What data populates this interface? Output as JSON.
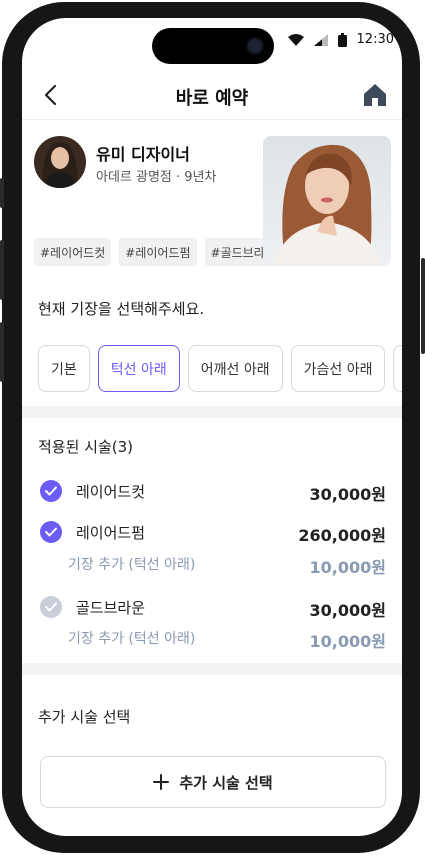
{
  "status_bar": {
    "time": "12:30"
  },
  "header": {
    "title": "바로 예약"
  },
  "designer": {
    "name": "유미 디자이너",
    "meta": "아데르 광명점 · 9년차",
    "tags": [
      "#레이어드컷",
      "#레이어드펌",
      "#골드브라"
    ]
  },
  "length": {
    "prompt": "현재 기장을 선택해주세요.",
    "options": [
      {
        "label": "기본",
        "selected": false
      },
      {
        "label": "턱선 아래",
        "selected": true
      },
      {
        "label": "어깨선 아래",
        "selected": false
      },
      {
        "label": "가슴선 아래",
        "selected": false
      }
    ]
  },
  "applied": {
    "title": "적용된 시술(3)",
    "services": [
      {
        "name": "레이어드컷",
        "price": "30,000원",
        "checked": true
      },
      {
        "name": "레이어드펌",
        "price": "260,000원",
        "checked": true,
        "extra_label": "기장 추가 (턱선 아래)",
        "extra_price": "10,000원"
      },
      {
        "name": "골드브라운",
        "price": "30,000원",
        "checked": false,
        "extra_label": "기장 추가 (턱선 아래)",
        "extra_price": "10,000원"
      }
    ]
  },
  "additional": {
    "title": "추가 시술 선택",
    "button_label": "추가 시술 선택"
  },
  "colors": {
    "accent": "#6b5cf6",
    "sub_text": "#8a9ab3",
    "unchecked": "#c9ced8"
  }
}
